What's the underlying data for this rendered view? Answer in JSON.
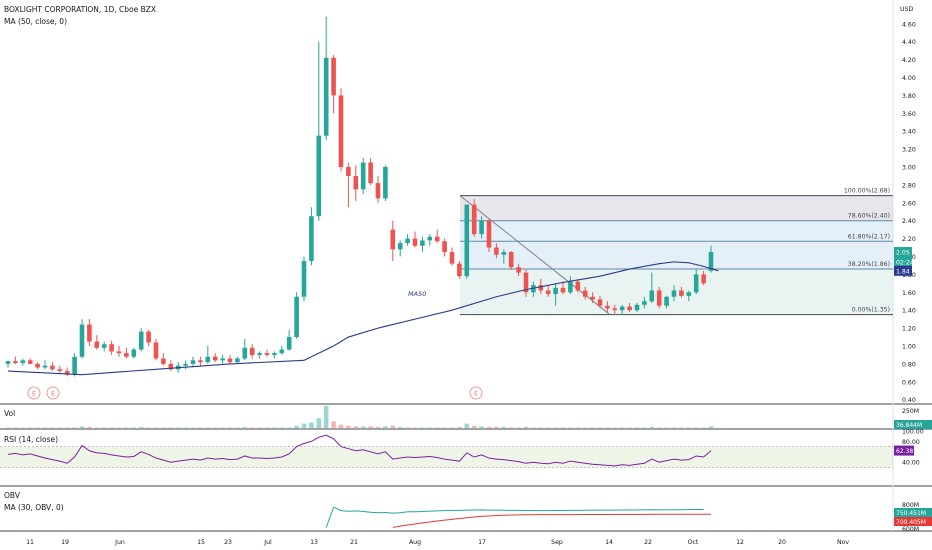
{
  "header": {
    "title": "BOXLIGHT CORPORATION, 1D, Cboe BZX",
    "ma_label": "MA (50, close, 0)",
    "currency": "USD"
  },
  "panes": {
    "vol_label": "Vol",
    "rsi_label": "RSI (14, close)",
    "obv_label": "OBV",
    "obv_ma_label": "MA (30, OBV, 0)"
  },
  "colors": {
    "up": "#26a69a",
    "down": "#ef5350",
    "ma": "#2b3a8c",
    "rsi": "#7b1fa2",
    "obv": "#26a69a",
    "obv_ma": "#e53935",
    "fib_fill_top": "#d1d4dc",
    "fib_fill_mid": "#cfe2f3",
    "fib_fill_low": "#d7ebe8"
  },
  "chart_data": {
    "type": "candlestick",
    "price_ticks": [
      "4.60",
      "4.40",
      "4.20",
      "4.00",
      "3.80",
      "3.60",
      "3.40",
      "3.20",
      "3.00",
      "2.80",
      "2.60",
      "2.40",
      "2.20",
      "2.00",
      "1.80",
      "1.60",
      "1.40",
      "1.20",
      "1.00",
      "0.80",
      "0.60",
      "0.40"
    ],
    "ylim": [
      0.36,
      4.72
    ],
    "x_labels": [
      "11",
      "19",
      "Jun",
      "15",
      "23",
      "Jul",
      "13",
      "21",
      "Aug",
      "17",
      "Sep",
      "14",
      "22",
      "Oct",
      "12",
      "20",
      "Nov"
    ],
    "ma_label_on_chart": "MA50",
    "earnings_markers": [
      "E",
      "E",
      "E"
    ],
    "price_badges": {
      "last": "2.05",
      "countdown": "02:24",
      "ma": "1.84"
    },
    "candles": [
      [
        0.8,
        0.84,
        0.76,
        0.83
      ],
      [
        0.83,
        0.88,
        0.8,
        0.81
      ],
      [
        0.81,
        0.86,
        0.78,
        0.84
      ],
      [
        0.84,
        0.86,
        0.8,
        0.8
      ],
      [
        0.8,
        0.82,
        0.74,
        0.76
      ],
      [
        0.76,
        0.84,
        0.74,
        0.78
      ],
      [
        0.78,
        0.82,
        0.72,
        0.74
      ],
      [
        0.74,
        0.78,
        0.7,
        0.72
      ],
      [
        0.72,
        0.76,
        0.66,
        0.68
      ],
      [
        0.68,
        0.92,
        0.66,
        0.88
      ],
      [
        0.88,
        1.3,
        0.86,
        1.24
      ],
      [
        1.24,
        1.3,
        1.0,
        1.05
      ],
      [
        1.05,
        1.12,
        0.96,
        0.98
      ],
      [
        0.98,
        1.05,
        0.94,
        1.02
      ],
      [
        1.02,
        1.06,
        0.9,
        0.94
      ],
      [
        0.94,
        1.0,
        0.88,
        0.92
      ],
      [
        0.92,
        0.98,
        0.86,
        0.88
      ],
      [
        0.88,
        0.98,
        0.86,
        0.96
      ],
      [
        0.96,
        1.2,
        0.94,
        1.16
      ],
      [
        1.16,
        1.18,
        1.0,
        1.04
      ],
      [
        1.04,
        1.08,
        0.84,
        0.86
      ],
      [
        0.86,
        0.92,
        0.78,
        0.8
      ],
      [
        0.8,
        0.84,
        0.72,
        0.74
      ],
      [
        0.74,
        0.82,
        0.7,
        0.78
      ],
      [
        0.78,
        0.84,
        0.74,
        0.8
      ],
      [
        0.8,
        0.88,
        0.76,
        0.84
      ],
      [
        0.84,
        0.88,
        0.78,
        0.82
      ],
      [
        0.82,
        1.0,
        0.8,
        0.88
      ],
      [
        0.88,
        0.92,
        0.82,
        0.84
      ],
      [
        0.84,
        0.9,
        0.8,
        0.86
      ],
      [
        0.86,
        0.9,
        0.8,
        0.82
      ],
      [
        0.82,
        0.88,
        0.8,
        0.86
      ],
      [
        0.86,
        1.08,
        0.84,
        0.98
      ],
      [
        0.98,
        1.02,
        0.86,
        0.9
      ],
      [
        0.9,
        0.94,
        0.86,
        0.92
      ],
      [
        0.92,
        0.96,
        0.88,
        0.9
      ],
      [
        0.9,
        0.94,
        0.86,
        0.92
      ],
      [
        0.92,
        1.0,
        0.9,
        0.96
      ],
      [
        0.96,
        1.18,
        0.95,
        1.1
      ],
      [
        1.1,
        1.6,
        1.08,
        1.55
      ],
      [
        1.55,
        2.0,
        1.5,
        1.95
      ],
      [
        1.95,
        2.55,
        1.9,
        2.45
      ],
      [
        2.45,
        4.4,
        2.4,
        3.35
      ],
      [
        3.35,
        4.68,
        3.3,
        4.22
      ],
      [
        4.22,
        4.25,
        3.6,
        3.8
      ],
      [
        3.8,
        3.88,
        2.95,
        3.0
      ],
      [
        3.0,
        3.05,
        2.55,
        2.9
      ],
      [
        2.9,
        3.02,
        2.62,
        2.75
      ],
      [
        2.75,
        3.1,
        2.7,
        3.05
      ],
      [
        3.05,
        3.1,
        2.8,
        2.82
      ],
      [
        2.82,
        2.9,
        2.6,
        2.65
      ],
      [
        2.65,
        3.02,
        2.62,
        3.0
      ],
      [
        2.3,
        2.4,
        1.95,
        2.08
      ],
      [
        2.08,
        2.18,
        2.0,
        2.15
      ],
      [
        2.15,
        2.25,
        2.12,
        2.2
      ],
      [
        2.2,
        2.28,
        2.1,
        2.12
      ],
      [
        2.12,
        2.22,
        2.05,
        2.18
      ],
      [
        2.18,
        2.25,
        2.12,
        2.22
      ],
      [
        2.22,
        2.3,
        2.15,
        2.17
      ],
      [
        2.17,
        2.2,
        2.0,
        2.05
      ],
      [
        2.05,
        2.1,
        1.9,
        1.92
      ],
      [
        1.92,
        1.95,
        1.75,
        1.78
      ],
      [
        1.78,
        2.52,
        1.75,
        2.58
      ],
      [
        2.58,
        2.64,
        2.22,
        2.25
      ],
      [
        2.25,
        2.45,
        2.2,
        2.4
      ],
      [
        2.4,
        2.42,
        2.05,
        2.1
      ],
      [
        2.1,
        2.15,
        1.98,
        2.02
      ],
      [
        2.02,
        2.08,
        1.92,
        2.05
      ],
      [
        2.05,
        2.06,
        1.85,
        1.88
      ],
      [
        1.88,
        1.92,
        1.78,
        1.82
      ],
      [
        1.82,
        1.85,
        1.55,
        1.6
      ],
      [
        1.6,
        1.72,
        1.55,
        1.68
      ],
      [
        1.68,
        1.75,
        1.58,
        1.62
      ],
      [
        1.62,
        1.68,
        1.55,
        1.58
      ],
      [
        1.58,
        1.7,
        1.45,
        1.65
      ],
      [
        1.65,
        1.72,
        1.58,
        1.6
      ],
      [
        1.6,
        1.78,
        1.58,
        1.72
      ],
      [
        1.72,
        1.75,
        1.6,
        1.62
      ],
      [
        1.62,
        1.66,
        1.52,
        1.55
      ],
      [
        1.55,
        1.6,
        1.48,
        1.52
      ],
      [
        1.52,
        1.56,
        1.42,
        1.45
      ],
      [
        1.45,
        1.5,
        1.38,
        1.42
      ],
      [
        1.42,
        1.46,
        1.36,
        1.4
      ],
      [
        1.4,
        1.46,
        1.36,
        1.44
      ],
      [
        1.44,
        1.48,
        1.38,
        1.4
      ],
      [
        1.4,
        1.48,
        1.38,
        1.46
      ],
      [
        1.46,
        1.55,
        1.42,
        1.5
      ],
      [
        1.5,
        1.82,
        1.48,
        1.62
      ],
      [
        1.62,
        1.66,
        1.42,
        1.45
      ],
      [
        1.45,
        1.56,
        1.42,
        1.55
      ],
      [
        1.55,
        1.68,
        1.5,
        1.62
      ],
      [
        1.62,
        1.66,
        1.54,
        1.56
      ],
      [
        1.56,
        1.62,
        1.5,
        1.6
      ],
      [
        1.6,
        1.86,
        1.58,
        1.8
      ],
      [
        1.8,
        1.84,
        1.68,
        1.7
      ],
      [
        1.84,
        2.12,
        1.82,
        2.05
      ]
    ],
    "ma50": [
      [
        0,
        0.72
      ],
      [
        10,
        0.68
      ],
      [
        20,
        0.74
      ],
      [
        30,
        0.8
      ],
      [
        40,
        0.84
      ],
      [
        42,
        0.92
      ],
      [
        44,
        1.0
      ],
      [
        46,
        1.1
      ],
      [
        50,
        1.2
      ],
      [
        55,
        1.3
      ],
      [
        60,
        1.4
      ],
      [
        66,
        1.55
      ],
      [
        70,
        1.63
      ],
      [
        75,
        1.71
      ],
      [
        80,
        1.78
      ],
      [
        84,
        1.86
      ],
      [
        88,
        1.92
      ],
      [
        90,
        1.94
      ],
      [
        92,
        1.93
      ],
      [
        94,
        1.89
      ],
      [
        96,
        1.84
      ]
    ],
    "fib_levels": [
      {
        "label": "100.00%(2.68)",
        "value": 2.68
      },
      {
        "label": "78.60%(2.40)",
        "value": 2.4
      },
      {
        "label": "61.80%(2.17)",
        "value": 2.17
      },
      {
        "label": "38.20%(1.86)",
        "value": 1.86
      },
      {
        "label": "0.00%(1.35)",
        "value": 1.35
      }
    ],
    "volume": {
      "ticks": [
        "250M"
      ],
      "badge": "36.844M",
      "bars": [
        1,
        1,
        1,
        1,
        1,
        1,
        1,
        1,
        1,
        1,
        3,
        2,
        1,
        1,
        1,
        1,
        1,
        1,
        2,
        1,
        1,
        1,
        1,
        1,
        1,
        1,
        1,
        1,
        1,
        1,
        1,
        1,
        2,
        1,
        1,
        1,
        1,
        1,
        1,
        4,
        8,
        10,
        18,
        40,
        12,
        6,
        4,
        3,
        3,
        3,
        2,
        3,
        4,
        2,
        1,
        1,
        1,
        1,
        1,
        1,
        1,
        2,
        8,
        4,
        3,
        2,
        2,
        2,
        1,
        1,
        2,
        1,
        1,
        1,
        1,
        1,
        1,
        1,
        1,
        1,
        1,
        1,
        1,
        1,
        1,
        1,
        1,
        2,
        1,
        1,
        1,
        1,
        1,
        1,
        1,
        3
      ]
    },
    "rsi": {
      "ticks": [
        "100.00",
        "80.00",
        "40.00"
      ],
      "badge": "62.38",
      "band": [
        30,
        70
      ],
      "values": [
        55,
        57,
        54,
        56,
        52,
        48,
        45,
        42,
        38,
        50,
        72,
        62,
        58,
        57,
        54,
        52,
        50,
        51,
        60,
        55,
        48,
        44,
        40,
        42,
        44,
        46,
        44,
        48,
        46,
        47,
        45,
        46,
        52,
        48,
        48,
        47,
        48,
        50,
        56,
        70,
        76,
        80,
        88,
        92,
        85,
        70,
        66,
        62,
        64,
        60,
        56,
        60,
        46,
        48,
        50,
        49,
        50,
        51,
        49,
        46,
        44,
        42,
        58,
        50,
        54,
        48,
        46,
        45,
        43,
        41,
        38,
        40,
        38,
        37,
        40,
        38,
        42,
        40,
        38,
        36,
        35,
        34,
        33,
        35,
        34,
        36,
        38,
        46,
        40,
        43,
        46,
        44,
        45,
        52,
        50,
        62
      ]
    },
    "obv": {
      "ticks": [
        "800M",
        "600M"
      ],
      "badges": [
        "750.451M",
        "709.405M"
      ],
      "values": [
        null,
        null,
        null,
        null,
        null,
        null,
        null,
        null,
        null,
        null,
        null,
        null,
        null,
        null,
        null,
        null,
        null,
        null,
        null,
        null,
        null,
        null,
        null,
        null,
        null,
        null,
        null,
        null,
        null,
        null,
        null,
        null,
        null,
        null,
        null,
        null,
        null,
        null,
        null,
        null,
        null,
        null,
        null,
        595,
        770,
        740,
        735,
        738,
        732,
        726,
        722,
        724,
        718,
        722,
        730,
        730,
        732,
        736,
        738,
        740,
        742,
        742,
        744,
        745,
        746,
        744,
        744,
        743,
        742,
        742,
        741,
        740,
        740,
        740,
        741,
        741,
        742,
        742,
        743,
        743,
        744,
        744,
        744,
        745,
        745,
        746,
        747,
        748,
        747,
        747,
        748,
        748,
        749,
        750,
        750
      ],
      "ma": [
        null,
        null,
        null,
        null,
        null,
        null,
        null,
        null,
        null,
        null,
        null,
        null,
        null,
        null,
        null,
        null,
        null,
        null,
        null,
        null,
        null,
        null,
        null,
        null,
        null,
        null,
        null,
        null,
        null,
        null,
        null,
        null,
        null,
        null,
        null,
        null,
        null,
        null,
        null,
        null,
        null,
        null,
        null,
        null,
        null,
        null,
        null,
        null,
        null,
        null,
        null,
        null,
        595,
        606,
        616,
        625,
        634,
        642,
        650,
        658,
        665,
        672,
        679,
        685,
        690,
        694,
        698,
        700,
        702,
        703,
        704,
        704,
        705,
        705,
        705,
        706,
        706,
        706,
        707,
        707,
        707,
        707,
        708,
        708,
        708,
        708,
        708,
        709,
        709,
        709,
        709,
        709,
        709,
        709,
        709,
        709
      ]
    }
  }
}
